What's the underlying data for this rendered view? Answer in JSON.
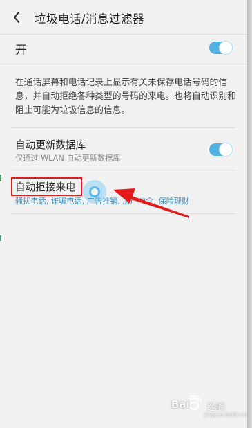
{
  "header": {
    "title": "垃圾电话/消息过滤器",
    "back_icon": "chevron-left-icon"
  },
  "master_switch": {
    "label": "开",
    "state": "on"
  },
  "description": "在通话屏幕和电话记录上显示有关未保存电话号码的信息，并自动拒绝各种类型的号码的来电。也将自动识别和阻止可能为垃圾信息的信息。",
  "auto_update": {
    "title": "自动更新数据库",
    "subtitle": "仅通过 WLAN 自动更新数据库",
    "state": "on"
  },
  "auto_reject": {
    "title": "自动拒接来电",
    "categories": "骚扰电话, 诈骗电话, 广告推销, 房产中介, 保险理财"
  },
  "colors": {
    "accent": "#52b1e3",
    "annotation": "#e21a1a",
    "category_text": "#3d8fbd"
  },
  "watermark": {
    "brand": "Bai",
    "brand_suffix": "经验",
    "sub": "jingyan.baidu.com"
  }
}
